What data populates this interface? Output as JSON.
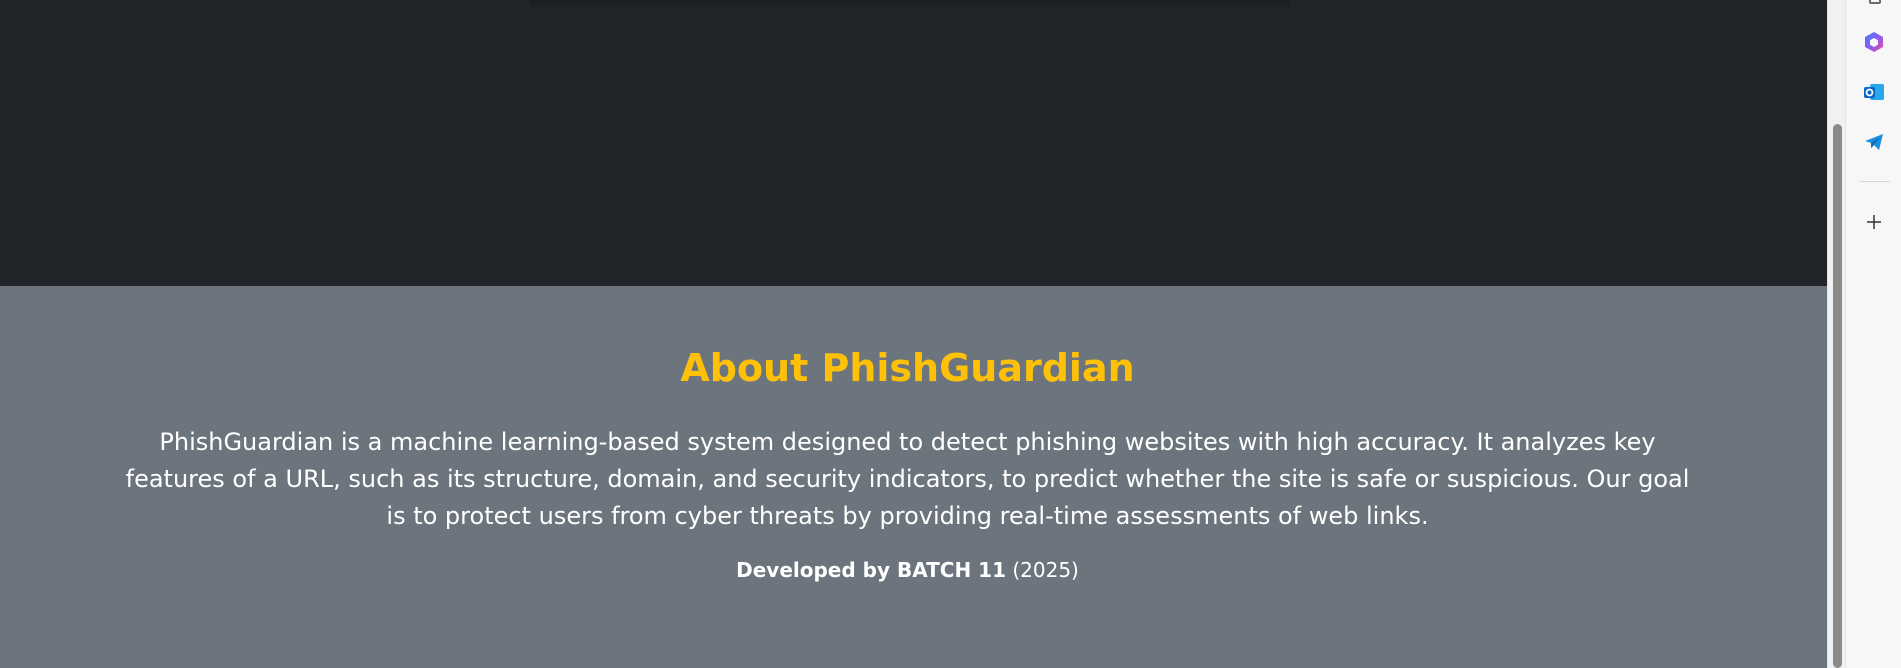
{
  "about": {
    "title": "About PhishGuardian",
    "description": "PhishGuardian is a machine learning-based system designed to detect phishing websites with high accuracy. It analyzes key features of a URL, such as its structure, domain, and security indicators, to predict whether the site is safe or suspicious. Our goal is to protect users from cyber threats by providing real-time assessments of web links.",
    "credit_prefix": "Developed by ",
    "credit_team": "BATCH 11",
    "credit_year": " (2025)"
  },
  "sidebar": {
    "icons": [
      "copilot-icon",
      "outlook-icon",
      "telegram-icon",
      "add-icon"
    ]
  },
  "colors": {
    "dark_section": "#212529",
    "about_section": "#6c757d",
    "accent": "#ffc107",
    "text": "#ffffff"
  }
}
